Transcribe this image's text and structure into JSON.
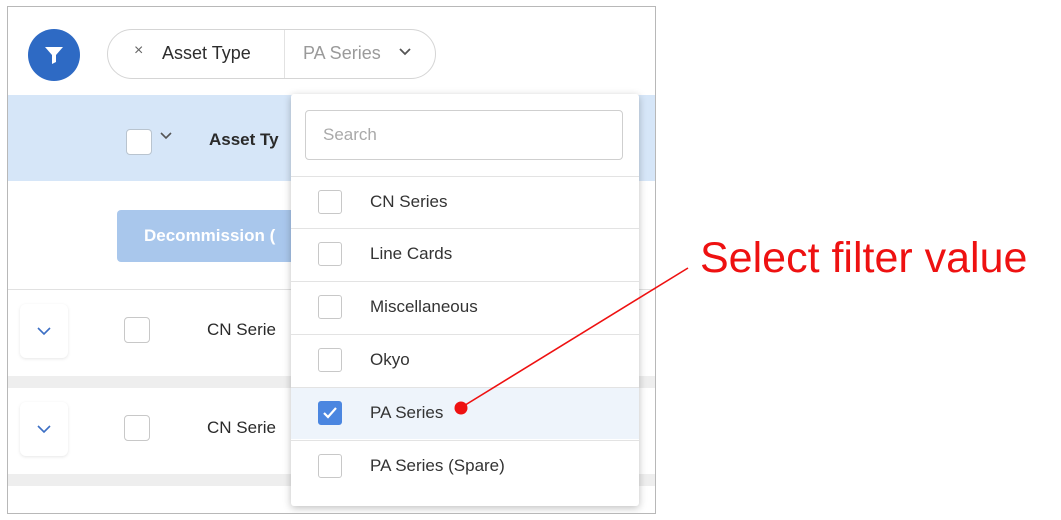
{
  "toolbar": {
    "filter_icon": "funnel-icon",
    "chip": {
      "remove_symbol": "×",
      "label": "Asset Type",
      "value": "PA Series",
      "caret_icon": "chevron-down-icon"
    }
  },
  "table": {
    "header": {
      "column_title": "Asset Ty"
    },
    "action_button": "Decommission (",
    "rows": [
      {
        "text": "CN Serie"
      },
      {
        "text": "CN Serie"
      }
    ]
  },
  "dropdown": {
    "search_placeholder": "Search",
    "options": [
      {
        "label": "CN Series",
        "checked": false
      },
      {
        "label": "Line Cards",
        "checked": false
      },
      {
        "label": "Miscellaneous",
        "checked": false
      },
      {
        "label": "Okyo",
        "checked": false
      },
      {
        "label": "PA Series",
        "checked": true
      },
      {
        "label": "PA Series (Spare)",
        "checked": false
      }
    ]
  },
  "annotation": {
    "text": "Select filter value",
    "color": "#ee1111"
  },
  "colors": {
    "accent": "#2e6ac4",
    "header_bg": "#d6e6f8",
    "button_disabled": "#a9c7ec",
    "checkbox_checked": "#4b86e0"
  }
}
